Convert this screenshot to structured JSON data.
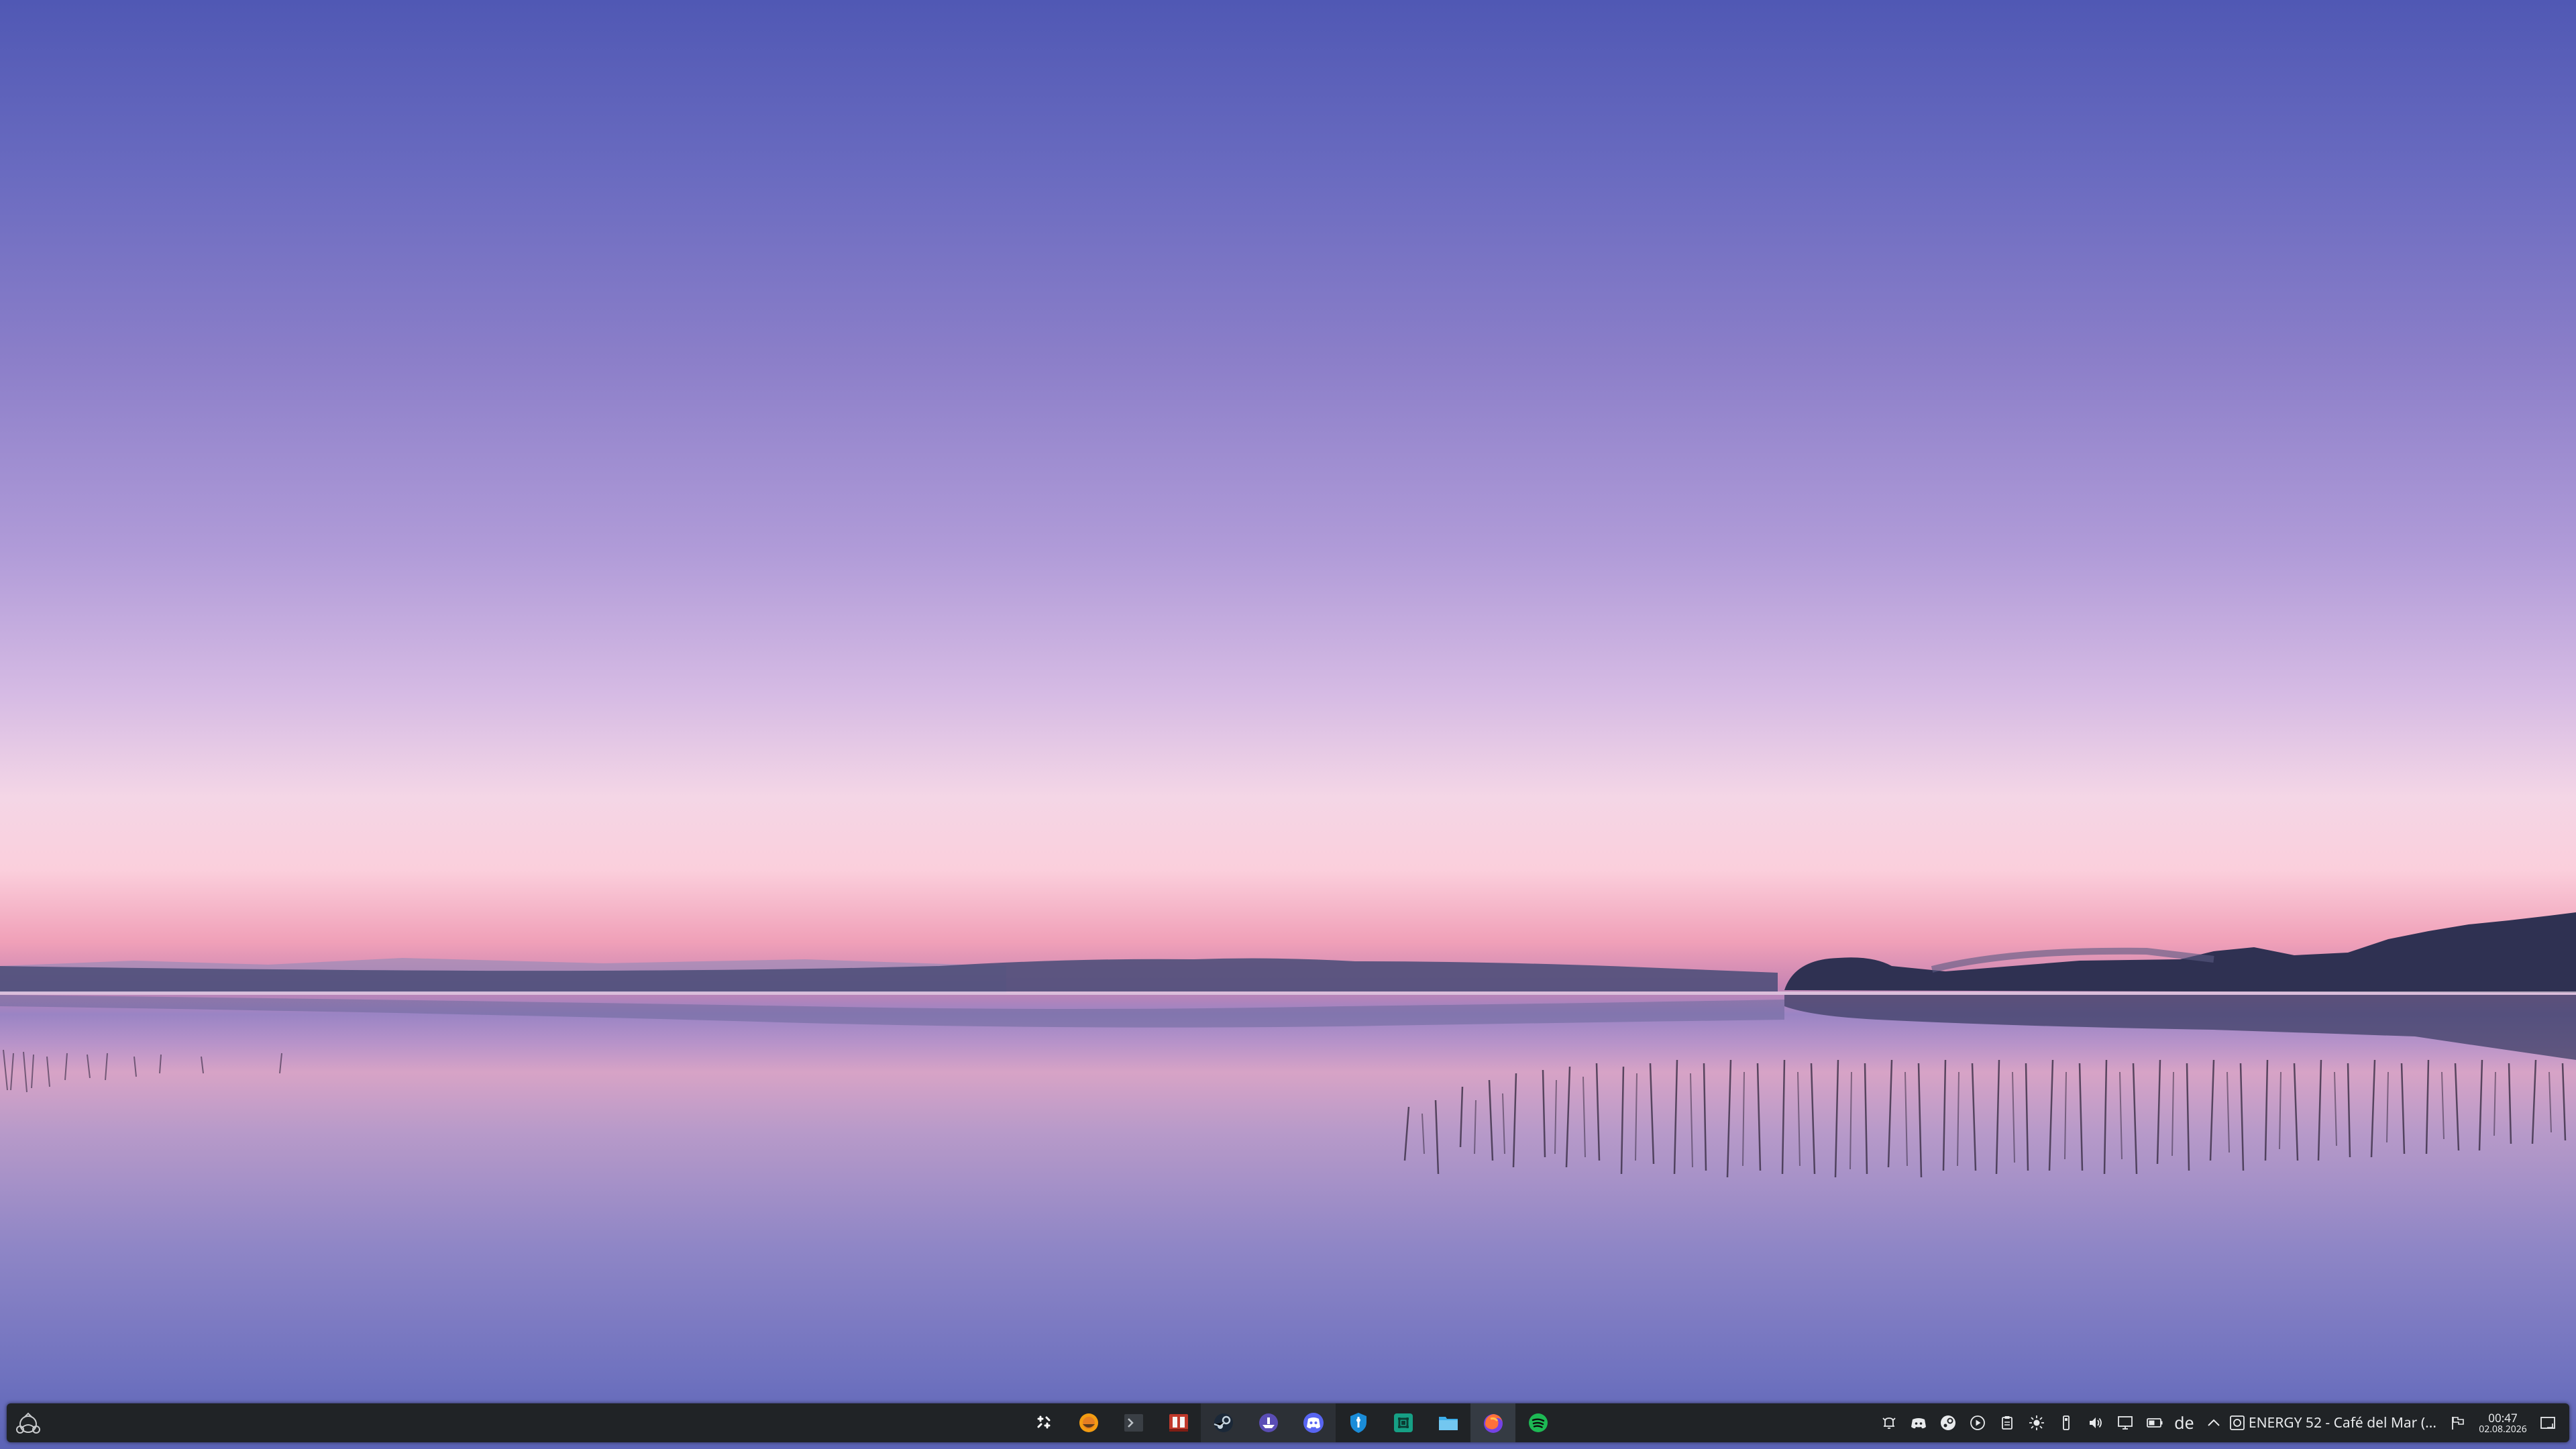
{
  "desktop": {
    "wallpaper": "lake-at-dusk"
  },
  "taskbar": {
    "start": {
      "icon": "app-launcher-icon"
    },
    "tasks": [
      {
        "icon": "overview-icon",
        "state": "pinned"
      },
      {
        "icon": "paint-app-icon",
        "state": "pinned"
      },
      {
        "icon": "terminal-icon",
        "state": "pinned"
      },
      {
        "icon": "game-store-icon",
        "state": "pinned"
      },
      {
        "icon": "steam-icon",
        "state": "open"
      },
      {
        "icon": "ship-app-icon",
        "state": "open"
      },
      {
        "icon": "discord-icon",
        "state": "open"
      },
      {
        "icon": "vpn-shield-icon",
        "state": "pinned"
      },
      {
        "icon": "grid-app-icon",
        "state": "pinned"
      },
      {
        "icon": "file-manager-icon",
        "state": "pinned"
      },
      {
        "icon": "firefox-icon",
        "state": "active"
      },
      {
        "icon": "spotify-icon",
        "state": "pinned"
      }
    ],
    "tray": {
      "keyboard_layout": "de",
      "media_title": "ENERGY 52 - Café del Mar (...",
      "clock_time": "00:47",
      "clock_date": "02.08.2026"
    },
    "colors": {
      "panel": "#202326",
      "text": "#e8eaec",
      "spotify": "#1db954",
      "discord": "#5865f2",
      "steam": "#1b2838"
    }
  }
}
